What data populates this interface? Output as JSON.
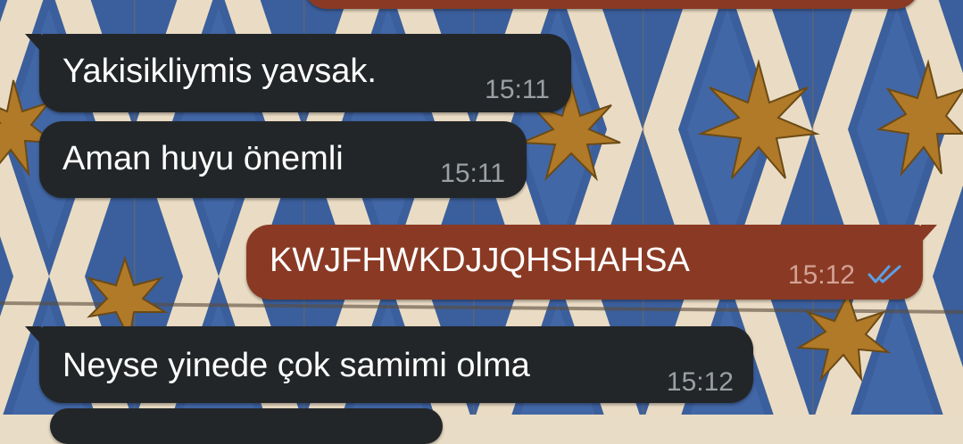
{
  "chat": {
    "messages": [
      {
        "direction": "incoming",
        "text": "Yakisikliymis yavsak.",
        "time": "15:11"
      },
      {
        "direction": "incoming",
        "text": "Aman huyu önemli",
        "time": "15:11"
      },
      {
        "direction": "outgoing",
        "text": "KWJFHWKDJJQHSHAHSA",
        "time": "15:12",
        "status": "read-double-check-icon"
      },
      {
        "direction": "incoming",
        "text": "Neyse yinede çok samimi olma",
        "time": "15:12"
      }
    ]
  },
  "colors": {
    "incoming_bubble": "#232628",
    "outgoing_bubble": "#8a3a24",
    "read_ticks": "#5aa0e6"
  }
}
